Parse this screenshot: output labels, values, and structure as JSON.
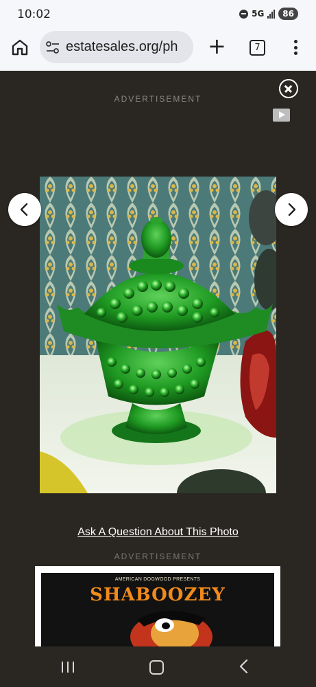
{
  "status_bar": {
    "time": "10:02",
    "network": "5G",
    "battery": "86"
  },
  "browser": {
    "url": "estatesales.org/ph",
    "tab_count": "7",
    "new_tab_symbol": "+"
  },
  "lightbox": {
    "ad_label_top": "ADVERTISEMENT",
    "ad_label_bottom": "ADVERTISEMENT",
    "ask_link": "Ask A Question About This Photo",
    "photo_subject": "green hobnail glass covered candy dish"
  },
  "ad": {
    "presenter": "AMERICAN DOGWOOD PRESENTS",
    "headline": "SHABOOZEY"
  },
  "icons": {
    "home": "home-icon",
    "site_settings": "tune-icon",
    "close": "close-circle-icon",
    "adchoices": "adchoices-icon",
    "prev": "chevron-left-icon",
    "next": "chevron-right-icon"
  },
  "colors": {
    "lightbox_bg": "#2a2723",
    "browser_chrome": "#f6f7fa",
    "glass_green": "#1f8a1f",
    "ad_headline": "#f08a1c"
  }
}
